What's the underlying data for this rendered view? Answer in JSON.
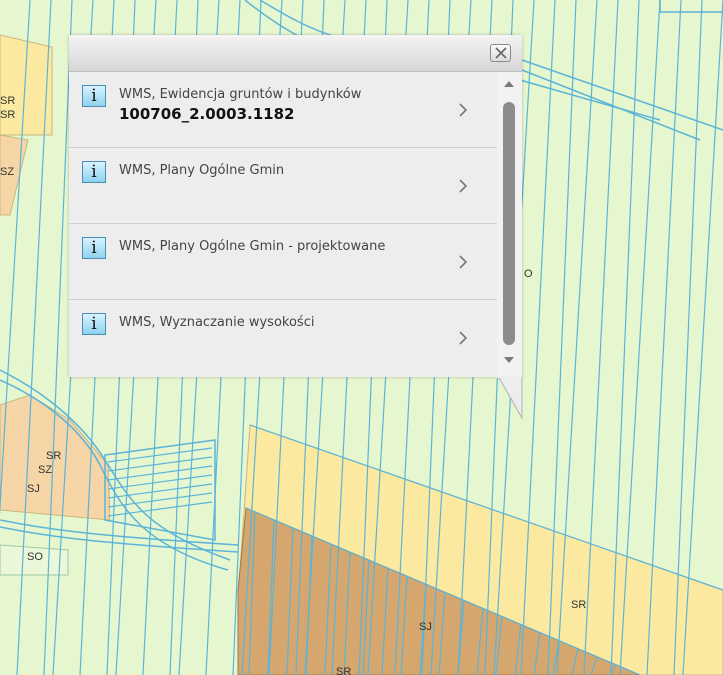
{
  "map": {
    "zone_labels": [
      "SR",
      "SR",
      "SZ",
      "SR",
      "SZ",
      "SJ",
      "SO",
      "O",
      "SJ",
      "SR",
      "SR"
    ]
  },
  "popup": {
    "close_icon": "close-icon",
    "items": [
      {
        "title": "WMS, Ewidencja gruntów i budynków",
        "value": "100706_2.0003.1182",
        "icon": "i"
      },
      {
        "title": "WMS, Plany Ogólne Gmin",
        "value": "",
        "icon": "i"
      },
      {
        "title": "WMS, Plany Ogólne Gmin - projektowane",
        "value": "",
        "icon": "i"
      },
      {
        "title": "WMS, Wyznaczanie wysokości",
        "value": "",
        "icon": "i"
      }
    ]
  },
  "colors": {
    "map_background": "#e6f7cf",
    "parcel_line": "#5ab4d8",
    "zone_yellow": "#fce9a0",
    "zone_orange": "#f6d6a6",
    "zone_brown": "#d5a66d",
    "info_icon": "#8fd2ef"
  }
}
